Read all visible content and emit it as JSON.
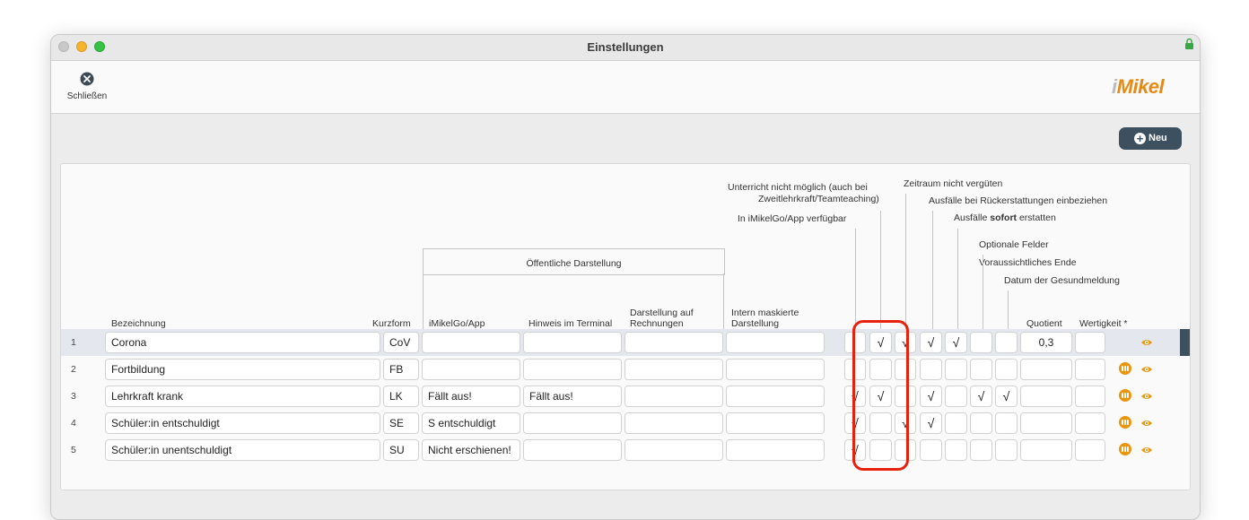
{
  "window": {
    "title": "Einstellungen"
  },
  "toolbar": {
    "close_label": "Schließen",
    "logo_prefix": "i",
    "logo_text": "Mikel"
  },
  "actions": {
    "new_label": "Neu"
  },
  "headers": {
    "unterricht_1": "Unterricht nicht möglich (auch bei",
    "unterricht_2": "Zweitlehrkraft/Teamteaching)",
    "imikelgo_app": "In iMikelGo/App verfügbar",
    "zeitraum": "Zeitraum nicht vergüten",
    "ausfaelle_rueck": "Ausfälle bei Rückerstattungen einbeziehen",
    "ausfaelle_sofort_pre": "Ausfälle ",
    "ausfaelle_sofort_bold": "sofort",
    "ausfaelle_sofort_post": " erstatten",
    "optionale": "Optionale Felder",
    "voraussichtlich": "Voraussichtliches Ende",
    "datum_gesund": "Datum der Gesundmeldung",
    "oeffentlich": "Öffentliche Darstellung",
    "bezeichnung": "Bezeichnung",
    "kurzform": "Kurzform",
    "imikelgo": "iMikelGo/App",
    "hinweis": "Hinweis im Terminal",
    "rechnung_1": "Darstellung auf",
    "rechnung_2": "Rechnungen",
    "intern_1": "Intern maskierte",
    "intern_2": "Darstellung",
    "quotient": "Quotient",
    "wertigkeit": "Wertigkeit *"
  },
  "rows": [
    {
      "num": "1",
      "bezeichnung": "Corona",
      "kurzform": "CoV",
      "app": "",
      "hinweis": "",
      "rechnung": "",
      "intern": "",
      "checks": [
        "",
        "√",
        "√",
        "√",
        "√",
        "",
        ""
      ],
      "quotient": "0,3",
      "wertigkeit": "",
      "selected": true,
      "people_icon": false
    },
    {
      "num": "2",
      "bezeichnung": "Fortbildung",
      "kurzform": "FB",
      "app": "",
      "hinweis": "",
      "rechnung": "",
      "intern": "",
      "checks": [
        "",
        "",
        "",
        "",
        "",
        "",
        ""
      ],
      "quotient": "",
      "wertigkeit": "",
      "selected": false,
      "people_icon": true
    },
    {
      "num": "3",
      "bezeichnung": "Lehrkraft krank",
      "kurzform": "LK",
      "app": "Fällt aus!",
      "hinweis": "Fällt aus!",
      "rechnung": "",
      "intern": "",
      "checks": [
        "√",
        "√",
        "",
        "√",
        "",
        "√",
        "√"
      ],
      "quotient": "",
      "wertigkeit": "",
      "selected": false,
      "people_icon": true
    },
    {
      "num": "4",
      "bezeichnung": "Schüler:in entschuldigt",
      "kurzform": "SE",
      "app": "S entschuldigt",
      "hinweis": "",
      "rechnung": "",
      "intern": "",
      "checks": [
        "√",
        "",
        "√",
        "√",
        "",
        "",
        ""
      ],
      "quotient": "",
      "wertigkeit": "",
      "selected": false,
      "people_icon": true
    },
    {
      "num": "5",
      "bezeichnung": "Schüler:in unentschuldigt",
      "kurzform": "SU",
      "app": "Nicht erschienen!",
      "hinweis": "",
      "rechnung": "",
      "intern": "",
      "checks": [
        "√",
        "",
        "",
        "",
        "",
        "",
        ""
      ],
      "quotient": "",
      "wertigkeit": "",
      "selected": false,
      "people_icon": true
    }
  ],
  "icons": {
    "close": "close-circle-icon",
    "add": "plus-circle-icon",
    "eye": "eye-icon",
    "people": "people-icon",
    "lock": "lock-icon"
  },
  "colors": {
    "accent_dark": "#3c5060",
    "accent_orange": "#e8960f",
    "highlight_red": "#e8210c"
  }
}
